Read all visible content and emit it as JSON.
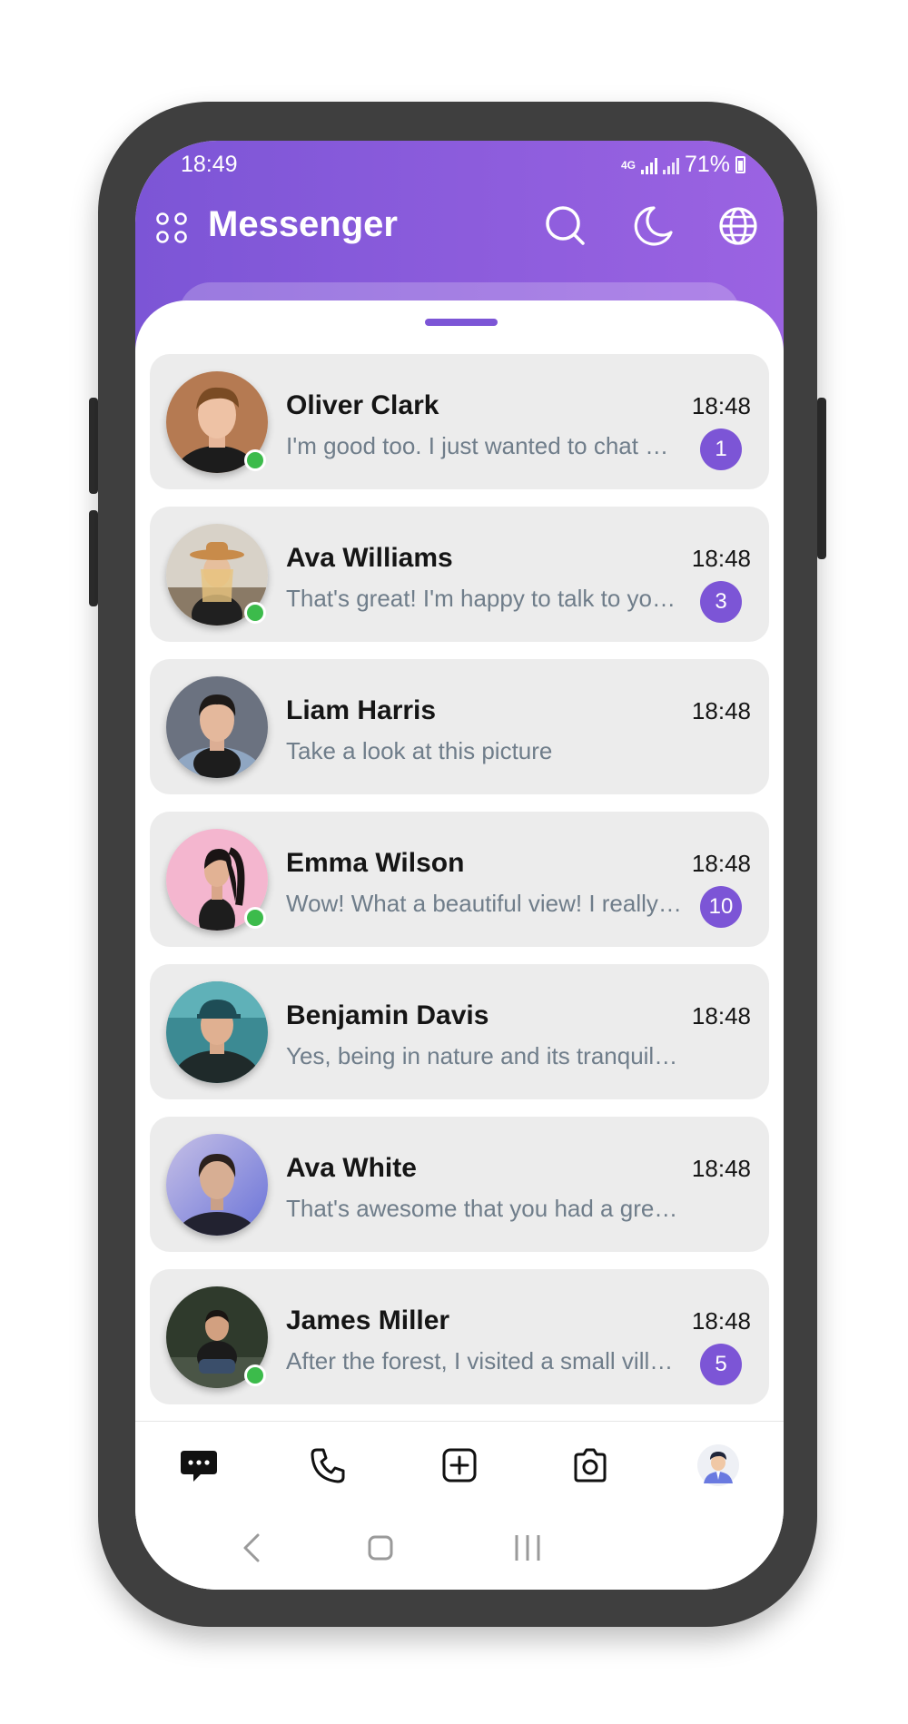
{
  "status_bar": {
    "time": "18:49",
    "network": "4G",
    "battery": "71%"
  },
  "header": {
    "title": "Messenger",
    "icons": [
      "apps-grid-icon",
      "search-icon",
      "moon-icon",
      "globe-icon"
    ]
  },
  "colors": {
    "accent": "#7c55d6",
    "online": "#3cbb4b",
    "card": "#ececec",
    "message_text": "#6f7d8a"
  },
  "chats": [
    {
      "name": "Oliver Clark",
      "time": "18:48",
      "message": "I'm good too. I just wanted to chat …",
      "unread": "1",
      "online": true
    },
    {
      "name": "Ava Williams",
      "time": "18:48",
      "message": "That's great! I'm happy to talk to yo…",
      "unread": "3",
      "online": true
    },
    {
      "name": "Liam Harris",
      "time": "18:48",
      "message": "Take a look at this picture",
      "unread": "",
      "online": false
    },
    {
      "name": "Emma Wilson",
      "time": "18:48",
      "message": "Wow! What a beautiful view! I really…",
      "unread": "10",
      "online": true
    },
    {
      "name": "Benjamin Davis",
      "time": "18:48",
      "message": "Yes, being in nature and its tranquil…",
      "unread": "",
      "online": false
    },
    {
      "name": "Ava White",
      "time": "18:48",
      "message": "That's awesome that you had a gre…",
      "unread": "",
      "online": false
    },
    {
      "name": "James Miller",
      "time": "18:48",
      "message": "After the forest, I visited a small vill…",
      "unread": "5",
      "online": true
    }
  ],
  "bottom_nav": {
    "items": [
      "chat-bubble-icon",
      "phone-icon",
      "add-square-icon",
      "camera-icon",
      "profile-avatar"
    ],
    "active": "chat-bubble-icon"
  },
  "system_nav": {
    "items": [
      "back-icon",
      "home-icon",
      "recents-icon"
    ]
  }
}
